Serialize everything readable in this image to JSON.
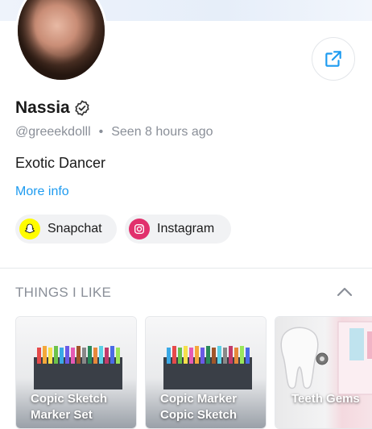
{
  "profile": {
    "name": "Nassia",
    "handle": "@greeekdolll",
    "seen": "Seen  8 hours ago",
    "bio": "Exotic Dancer",
    "more_info": "More info"
  },
  "socials": [
    {
      "label": "Snapchat",
      "icon": "snapchat-icon",
      "color": "#fffc00"
    },
    {
      "label": "Instagram",
      "icon": "instagram-icon",
      "color": "#e1306c"
    }
  ],
  "section": {
    "title": "THINGS I LIKE"
  },
  "likes": [
    {
      "title": "Copic Sketch Marker Set"
    },
    {
      "title": "Copic Marker Copic Sketch"
    },
    {
      "title": "Teeth Gems"
    }
  ],
  "colors": {
    "accent": "#1d9bf0",
    "muted": "#8a8f98"
  }
}
